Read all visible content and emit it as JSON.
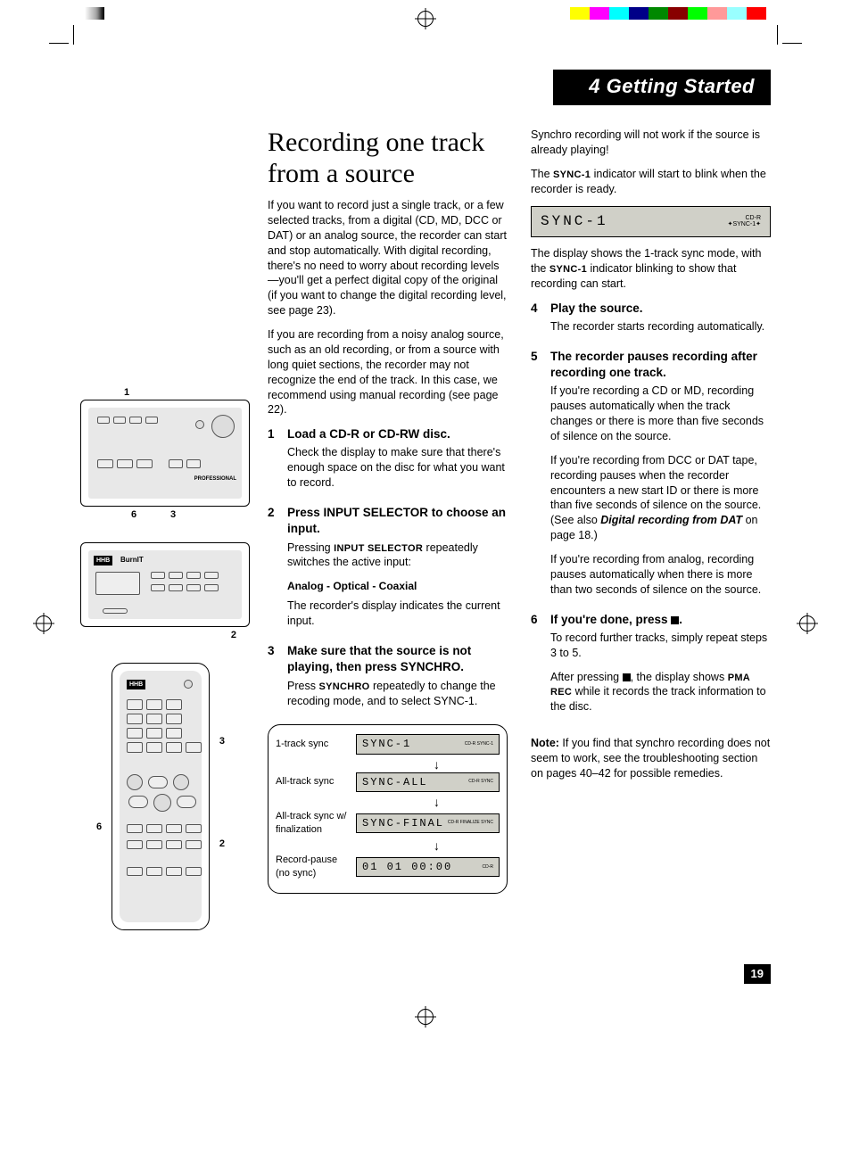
{
  "chapter": "4 Getting Started",
  "page_number": "19",
  "title": "Recording one track from a source",
  "intro_p1": "If you want to record just a single track, or a few selected tracks, from a digital (CD, MD, DCC or DAT) or an analog source, the recorder can start and stop automatically. With digital recording, there's no need to worry about recording levels—you'll get a perfect digital copy of the original (if you want to change the digital recording level, see page 23).",
  "intro_p2": "If you are recording from a noisy analog source, such as an old recording, or from a source with long quiet sections, the recorder may not recognize the end of the track. In this case, we recommend using manual recording (see page 22).",
  "steps": {
    "s1": {
      "num": "1",
      "title": "Load a CD-R or CD-RW disc.",
      "body": "Check the display to make sure that there's enough space on the disc for what you want to record."
    },
    "s2": {
      "num": "2",
      "title": "Press INPUT SELECTOR to choose an input.",
      "body_a": "Pressing ",
      "body_a_bold": "INPUT SELECTOR",
      "body_a_end": " repeatedly switches the active input:",
      "cycle": "Analog - Optical - Coaxial",
      "body_b": "The recorder's display indicates the current input."
    },
    "s3": {
      "num": "3",
      "title": "Make sure that the source is not playing, then press SYNCHRO.",
      "body_a": "Press ",
      "body_a_bold": "SYNCHRO",
      "body_a_end": " repeatedly to change the recoding mode, and to select SYNC-1."
    },
    "s4": {
      "num": "4",
      "title": "Play the source.",
      "body": "The recorder starts recording automatically."
    },
    "s5": {
      "num": "5",
      "title": "The recorder pauses recording after recording one track.",
      "body_a": "If you're recording a CD or MD, recording pauses automatically when the track changes or there is more than five seconds of silence on the source.",
      "body_b_a": "If you're recording from DCC or DAT tape, recording pauses when the recorder encounters a new start ID or there is more than five seconds of silence on the source. (See also ",
      "body_b_ref": "Digital recording from DAT",
      "body_b_end": " on page 18.)",
      "body_c": "If you're recording from analog, recording pauses automatically when there is more than two seconds of silence on the source."
    },
    "s6": {
      "num": "6",
      "title_a": "If you're done, press ",
      "title_b": ".",
      "body_a": "To record further tracks, simply repeat steps 3 to 5.",
      "body_b_a": "After pressing ",
      "body_b_mid": ", the display shows ",
      "body_b_bold": "PMA REC",
      "body_b_end": " while it records the track information to the disc."
    }
  },
  "col2_top_p1": "Synchro recording will not work if the source is already playing!",
  "col2_top_p2_a": "The ",
  "col2_top_p2_bold": "SYNC-1",
  "col2_top_p2_b": " indicator will start to blink when the recorder is ready.",
  "lcd_big": {
    "text": "SYNC-1",
    "tag1": "CD-R",
    "tag2": "SYNC-1"
  },
  "col2_after_lcd_a": "The display shows the 1-track sync mode, with the ",
  "col2_after_lcd_bold": "SYNC-1",
  "col2_after_lcd_b": " indicator blinking to show that recording can start.",
  "note_label": "Note:",
  "note_body": " If you find that synchro recording does not seem to work, see the troubleshooting section on pages 40–42 for possible remedies.",
  "sync_table": {
    "r1": {
      "label": "1-track sync",
      "lcd": "SYNC-1",
      "tag": "CD-R\nSYNC-1"
    },
    "r2": {
      "label": "All-track sync",
      "lcd": "SYNC-ALL",
      "tag": "CD-R\nSYNC"
    },
    "r3": {
      "label": "All-track sync w/ finalization",
      "lcd": "SYNC-FINAL",
      "tag": "CD-R\nFINALIZE\nSYNC"
    },
    "r4": {
      "label": "Record-pause (no sync)",
      "lcd": "01 01 00:00",
      "tag": "CD-R"
    }
  },
  "fig_callouts": {
    "c1": "1",
    "c3": "3",
    "c6": "6",
    "c2": "2"
  },
  "fig2_label": "BurnIT",
  "fig1_label": "PROFESSIONAL"
}
